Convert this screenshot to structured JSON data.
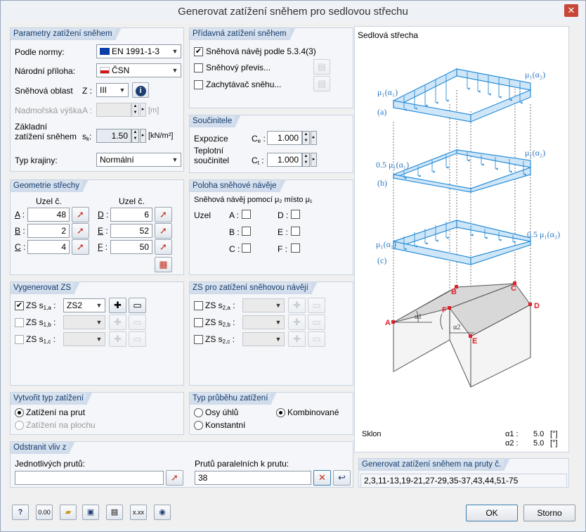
{
  "window": {
    "title": "Generovat zatížení sněhem pro sedlovou střechu",
    "close_glyph": "✕"
  },
  "params": {
    "header": "Parametry zatížení sněhem",
    "norm_label": "Podle normy:",
    "norm_value": "EN 1991-1-3",
    "annex_label": "Národní příloha:",
    "annex_value": "ČSN",
    "zone_label": "Sněhová oblast",
    "zone_sym": "Z :",
    "zone_value": "III",
    "alt_label": "Nadmořská výška",
    "alt_sym": "A :",
    "alt_unit": "[m]",
    "base_label_1": "Základní",
    "base_label_2": "zatížení sněhem",
    "base_sym": "s",
    "base_sub": "k",
    "base_colon": ":",
    "base_value": "1.50",
    "base_unit": "[kN/m²]",
    "terrain_label": "Typ krajiny:",
    "terrain_value": "Normální"
  },
  "extra": {
    "header": "Přídavná zatížení sněhem",
    "drift_label": "Sněhová návěj podle 5.3.4(3)",
    "overhang_label": "Sněhový převis...",
    "guard_label": "Zachytávač sněhu..."
  },
  "coef": {
    "header": "Součinitele",
    "exposure_label": "Expozice",
    "exposure_sym": "C",
    "exposure_sub": "e",
    "exposure_value": "1.000",
    "thermal_label_1": "Teplotní",
    "thermal_label_2": "součinitel",
    "thermal_sym": "C",
    "thermal_sub": "t",
    "thermal_value": "1.000",
    "colon": ":"
  },
  "geom": {
    "header": "Geometrie střechy",
    "col1": "Uzel č.",
    "col2": "Uzel č.",
    "rows": [
      {
        "l": "A",
        "v": "48"
      },
      {
        "l": "B",
        "v": "2"
      },
      {
        "l": "C",
        "v": "4"
      },
      {
        "l": "D",
        "v": "6"
      },
      {
        "l": "E",
        "v": "52"
      },
      {
        "l": "F",
        "v": "50"
      }
    ],
    "colon": ":"
  },
  "drift": {
    "header": "Poloha sněhové návěje",
    "desc": "Sněhová návěj pomocí μ₂ místo μ₁",
    "node_label": "Uzel",
    "nodes": [
      "A :",
      "B :",
      "C :",
      "D :",
      "E :",
      "F :"
    ]
  },
  "gen": {
    "header": "Vygenerovat ZS",
    "rows": [
      {
        "label": "ZS s",
        "sub": "1,a",
        "after": ":",
        "value": "ZS2"
      },
      {
        "label": "ZS s",
        "sub": "1,b",
        "after": ":",
        "value": ""
      },
      {
        "label": "ZS s",
        "sub": "1,c",
        "after": ":",
        "value": ""
      }
    ]
  },
  "gen2": {
    "header": "ZS pro zatížení sněhovou návějí",
    "rows": [
      {
        "label": "ZS s",
        "sub": "2,a",
        "after": ":"
      },
      {
        "label": "ZS s",
        "sub": "2,b",
        "after": ":"
      },
      {
        "label": "ZS s",
        "sub": "2,c",
        "after": ":"
      }
    ]
  },
  "ltype": {
    "header": "Vytvořit typ zatížení",
    "opt1": "Zatížení na prut",
    "opt2": "Zatížení na plochu"
  },
  "dist": {
    "header": "Typ průběhu zatížení",
    "opt1": "Osy úhlů",
    "opt2": "Konstantní",
    "opt3": "Kombinované"
  },
  "remove": {
    "header": "Odstranit vliv z",
    "single_label": "Jednotlivých prutů:",
    "single_value": "",
    "parallel_label": "Prutů paralelních k prutu:",
    "parallel_value": "38"
  },
  "picture": {
    "title": "Sedlová střecha",
    "labels": {
      "a": "(a)",
      "b": "(b)",
      "c": "(c)",
      "mu1a1": "μ₁(α₁)",
      "mu1a2": "μ₁(α₂)",
      "half_mu1a1": "0.5 μ₁(α₁)",
      "mu1a2b": "μ₁(α₂)",
      "mu1a1c": "μ₁(α₁)",
      "half_mu1a2c": "0.5 μ₁(α₂)",
      "A": "A",
      "B": "B",
      "C": "C",
      "D": "D",
      "E": "E",
      "F": "F",
      "al1": "α1",
      "al2": "α2"
    },
    "slope_label": "Sklon",
    "a1_label": "α1 :",
    "a1_value": "5.0",
    "a2_label": "α2 :",
    "a2_value": "5.0",
    "unit": "[°]"
  },
  "members": {
    "header": "Generovat zatížení sněhem na pruty č.",
    "value": "2,3,11-13,19-21,27-29,35-37,43,44,51-75"
  },
  "buttons": {
    "ok": "OK",
    "cancel": "Storno"
  }
}
